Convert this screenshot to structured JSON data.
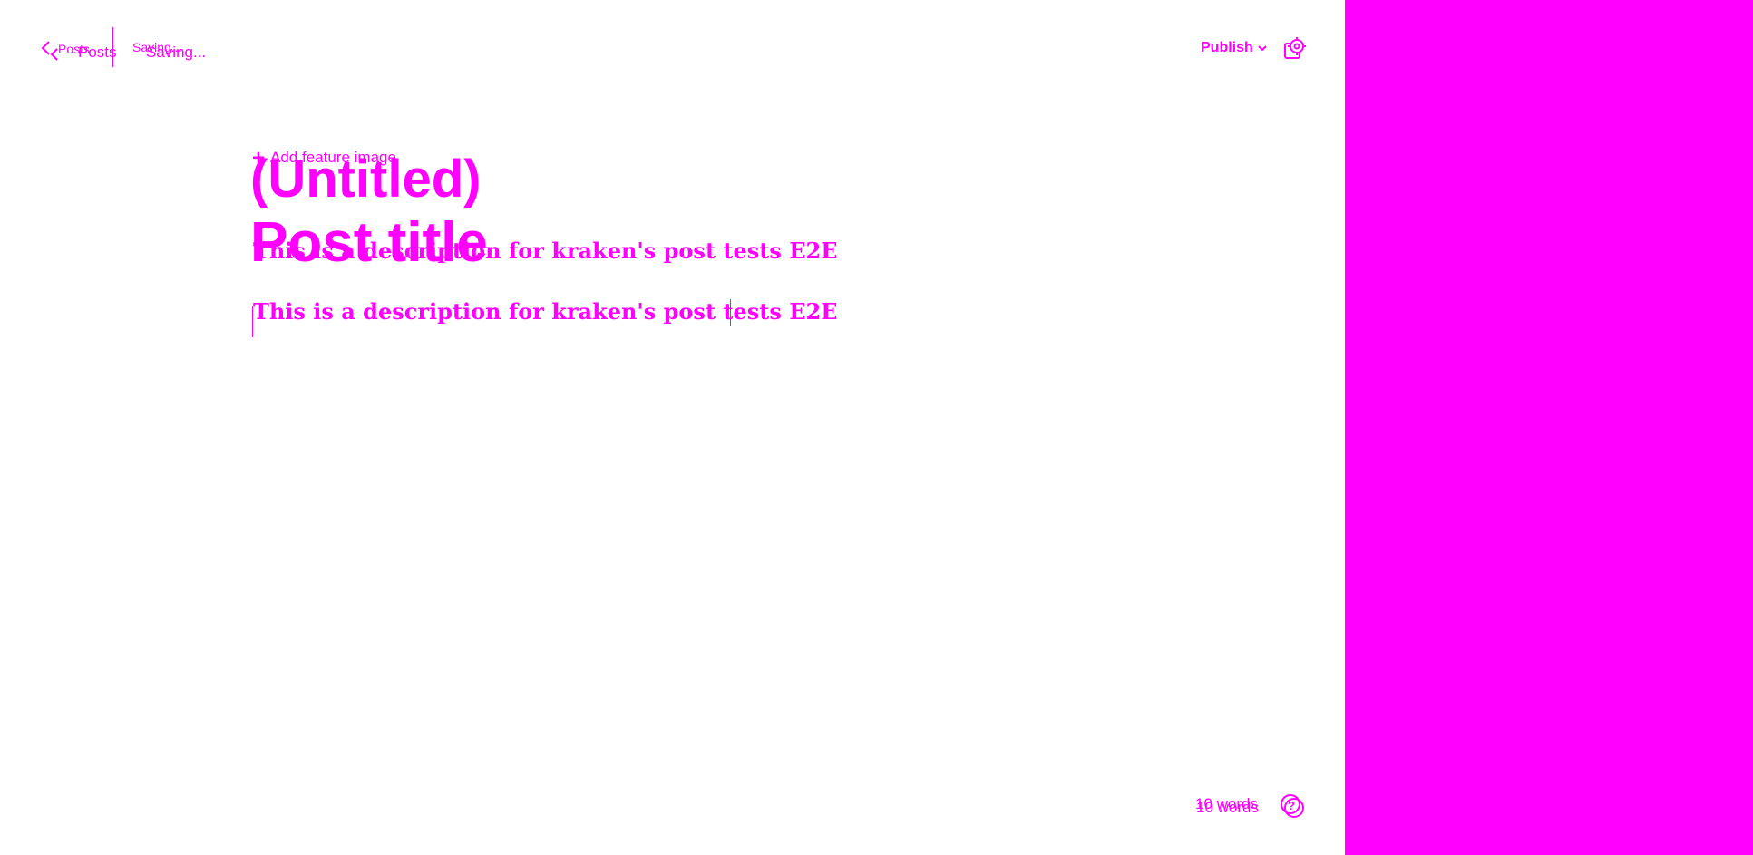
{
  "colors": {
    "accent": "#ff00ff",
    "background": "#ffffff"
  },
  "header": {
    "back_label": "Posts",
    "status": "Saving...",
    "publish_label": "Publish",
    "icons": {
      "back": "chevron-left-icon",
      "publish_dropdown": "chevron-down-icon",
      "settings": "gear-icon"
    }
  },
  "editor": {
    "feature_image_label": "Add feature image",
    "title_value": "(Untitled)",
    "title_placeholder": "Post title",
    "body_text": "This is a description for kraken's post tests E2E"
  },
  "footer": {
    "word_count": "10 words",
    "icons": {
      "help": "help-icon"
    }
  }
}
